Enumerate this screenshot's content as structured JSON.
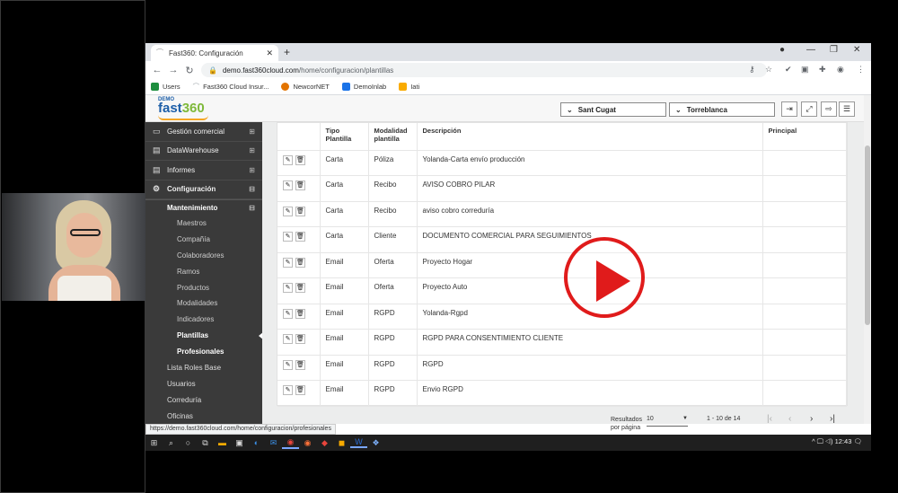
{
  "browser": {
    "tab_title": "Fast360: Configuración",
    "new_tab": "+",
    "url_host": "demo.fast360cloud.com",
    "url_path": "/home/configuracion/plantillas",
    "bookmarks": [
      {
        "label": "Users",
        "icon": "sheets-icon",
        "color": "#1e8e3e"
      },
      {
        "label": "Fast360 Cloud Insur...",
        "icon": "fast360-icon",
        "color": "#9aa0a6"
      },
      {
        "label": "NewcorNET",
        "icon": "newcor-icon",
        "color": "#e37400"
      },
      {
        "label": "DemoInlab",
        "icon": "folder-icon",
        "color": "#1a73e8"
      },
      {
        "label": "Iati",
        "icon": "folder-icon",
        "color": "#f9ab00"
      }
    ],
    "status_url": "https://demo.fast360cloud.com/home/configuracion/profesionales"
  },
  "app": {
    "logo_demo": "DEMO",
    "logo_fast": "fast",
    "logo_num": "360",
    "office_select": "Sant Cugat",
    "user_select": "Torreblanca"
  },
  "sidebar": {
    "sections": [
      {
        "label": "Gestión comercial",
        "icon": "monitor-icon"
      },
      {
        "label": "DataWarehouse",
        "icon": "document-icon"
      },
      {
        "label": "Informes",
        "icon": "document-icon"
      },
      {
        "label": "Configuración",
        "icon": "gear-icon"
      }
    ],
    "sub_header": "Mantenimiento",
    "leaves": [
      "Maestros",
      "Compañía",
      "Colaboradores",
      "Ramos",
      "Productos",
      "Modalidades",
      "Indicadores",
      "Plantillas",
      "Profesionales"
    ],
    "extra": [
      "Lista Roles Base",
      "Usuarios",
      "Correduría",
      "Oficinas"
    ]
  },
  "table": {
    "headers": {
      "tipo": "Tipo Plantilla",
      "modalidad": "Modalidad plantilla",
      "descripcion": "Descripción",
      "principal": "Principal"
    },
    "rows": [
      {
        "tipo": "Carta",
        "modalidad": "Póliza",
        "descripcion": "Yolanda-Carta envío producción"
      },
      {
        "tipo": "Carta",
        "modalidad": "Recibo",
        "descripcion": "AVISO COBRO PILAR"
      },
      {
        "tipo": "Carta",
        "modalidad": "Recibo",
        "descripcion": "aviso cobro correduría"
      },
      {
        "tipo": "Carta",
        "modalidad": "Cliente",
        "descripcion": "DOCUMENTO COMERCIAL PARA SEGUIMIENTOS"
      },
      {
        "tipo": "Email",
        "modalidad": "Oferta",
        "descripcion": "Proyecto Hogar"
      },
      {
        "tipo": "Email",
        "modalidad": "Oferta",
        "descripcion": "Proyecto Auto"
      },
      {
        "tipo": "Email",
        "modalidad": "RGPD",
        "descripcion": "Yolanda-Rgpd"
      },
      {
        "tipo": "Email",
        "modalidad": "RGPD",
        "descripcion": "RGPD PARA CONSENTIMIENTO CLIENTE"
      },
      {
        "tipo": "Email",
        "modalidad": "RGPD",
        "descripcion": "RGPD"
      },
      {
        "tipo": "Email",
        "modalidad": "RGPD",
        "descripcion": "Envio RGPD"
      }
    ]
  },
  "pager": {
    "label_line1": "Resultados",
    "label_line2": "por página",
    "per_page": "10",
    "range": "1 - 10 de 14"
  },
  "taskbar": {
    "time": "12:43"
  },
  "colors": {
    "play": "#e01b1b",
    "sidebar": "#3a3a3a",
    "brand": "#1c5ea8"
  }
}
